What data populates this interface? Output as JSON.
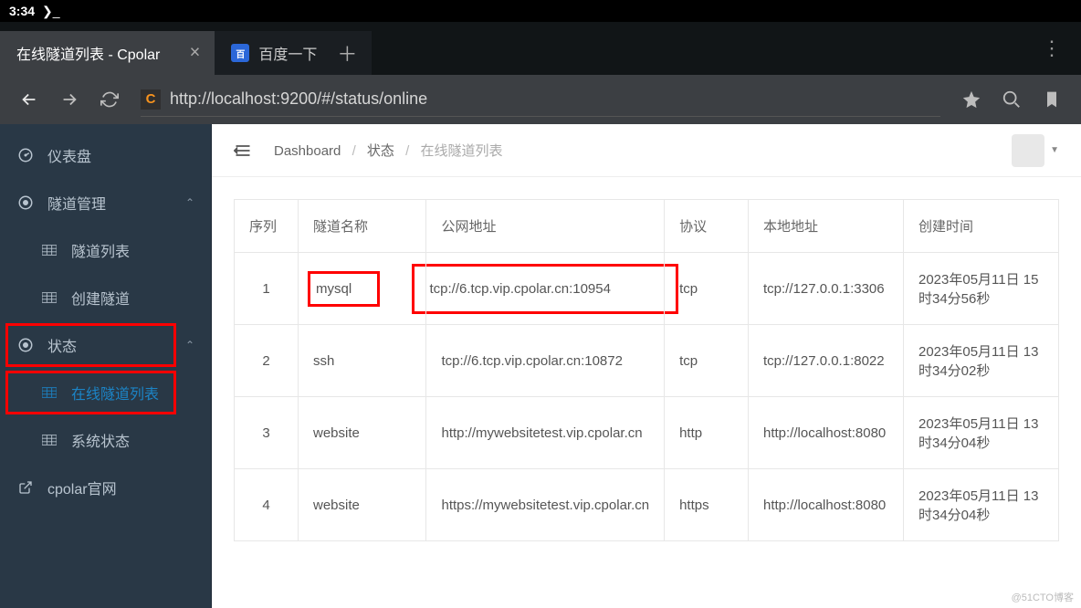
{
  "status_bar": {
    "time": "3:34",
    "term": "❯_"
  },
  "tabs": [
    {
      "title": "在线隧道列表 - Cpolar",
      "active": true
    },
    {
      "title": "百度一下",
      "active": false
    }
  ],
  "url": "http://localhost:9200/#/status/online",
  "favicon_letter": "C",
  "sidebar": {
    "items": [
      {
        "icon": "dashboard",
        "label": "仪表盘",
        "kind": "top"
      },
      {
        "icon": "target",
        "label": "隧道管理",
        "kind": "group",
        "chev": "up"
      },
      {
        "icon": "grid",
        "label": "隧道列表",
        "kind": "sub"
      },
      {
        "icon": "grid",
        "label": "创建隧道",
        "kind": "sub"
      },
      {
        "icon": "target",
        "label": "状态",
        "kind": "group",
        "chev": "up",
        "highlight": true
      },
      {
        "icon": "grid",
        "label": "在线隧道列表",
        "kind": "sub",
        "active": true,
        "highlight": true
      },
      {
        "icon": "grid",
        "label": "系统状态",
        "kind": "sub"
      },
      {
        "icon": "external",
        "label": "cpolar官网",
        "kind": "top"
      }
    ]
  },
  "breadcrumb": {
    "root": "Dashboard",
    "mid": "状态",
    "leaf": "在线隧道列表"
  },
  "table": {
    "headers": [
      "序列",
      "隧道名称",
      "公网地址",
      "协议",
      "本地地址",
      "创建时间"
    ],
    "rows": [
      {
        "idx": "1",
        "name": "mysql",
        "name_hl": true,
        "addr": "tcp://6.tcp.vip.cpolar.cn:10954",
        "addr_hl": true,
        "proto": "tcp",
        "local": "tcp://127.0.0.1:3306",
        "created": "2023年05月11日 15时34分56秒"
      },
      {
        "idx": "2",
        "name": "ssh",
        "addr": "tcp://6.tcp.vip.cpolar.cn:10872",
        "proto": "tcp",
        "local": "tcp://127.0.0.1:8022",
        "created": "2023年05月11日 13时34分02秒"
      },
      {
        "idx": "3",
        "name": "website",
        "addr": "http://mywebsitetest.vip.cpolar.cn",
        "proto": "http",
        "local": "http://localhost:8080",
        "created": "2023年05月11日 13时34分04秒"
      },
      {
        "idx": "4",
        "name": "website",
        "addr": "https://mywebsitetest.vip.cpolar.cn",
        "proto": "https",
        "local": "http://localhost:8080",
        "created": "2023年05月11日 13时34分04秒"
      }
    ]
  },
  "watermark": "@51CTO博客"
}
